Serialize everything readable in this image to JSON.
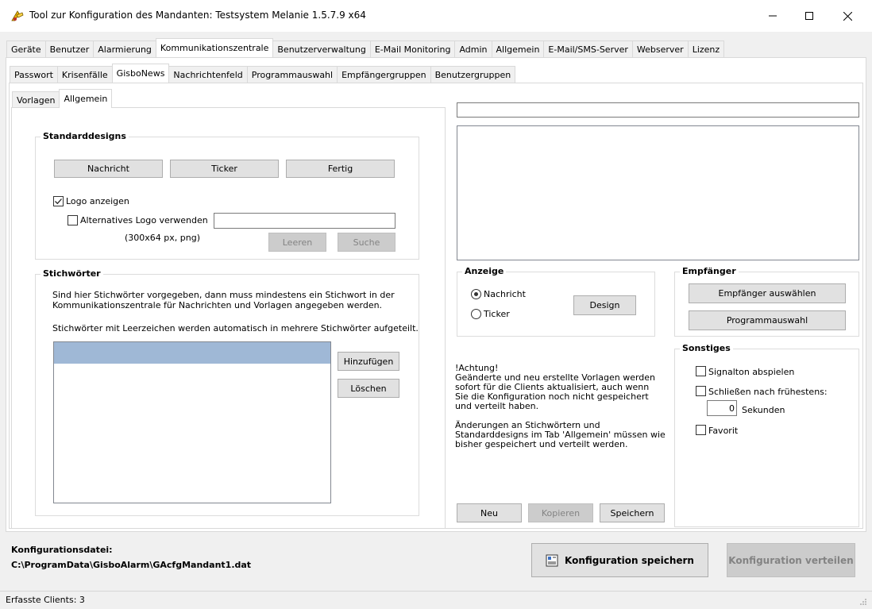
{
  "window": {
    "title": "Tool zur Konfiguration des Mandanten: Testsystem Melanie 1.5.7.9 x64"
  },
  "main_tabs": [
    {
      "label": "Geräte"
    },
    {
      "label": "Benutzer"
    },
    {
      "label": "Alarmierung"
    },
    {
      "label": "Kommunikationszentrale"
    },
    {
      "label": "Benutzerverwaltung"
    },
    {
      "label": "E-Mail Monitoring"
    },
    {
      "label": "Admin"
    },
    {
      "label": "Allgemein"
    },
    {
      "label": "E-Mail/SMS-Server"
    },
    {
      "label": "Webserver"
    },
    {
      "label": "Lizenz"
    }
  ],
  "sub_tabs": [
    {
      "label": "Passwort"
    },
    {
      "label": "Krisenfälle"
    },
    {
      "label": "GisboNews"
    },
    {
      "label": "Nachrichtenfeld"
    },
    {
      "label": "Programmauswahl"
    },
    {
      "label": "Empfängergruppen"
    },
    {
      "label": "Benutzergruppen"
    }
  ],
  "inner_tabs": [
    {
      "label": "Vorlagen"
    },
    {
      "label": "Allgemein"
    }
  ],
  "standarddesigns": {
    "title": "Standarddesigns",
    "btn_nachricht": "Nachricht",
    "btn_ticker": "Ticker",
    "btn_fertig": "Fertig",
    "logo_anzeigen": "Logo anzeigen",
    "logo_anzeigen_checked": true,
    "alt_logo": "Alternatives Logo verwenden",
    "alt_logo_checked": false,
    "alt_logo_path": "",
    "size_hint": "(300x64 px, png)",
    "btn_leeren": "Leeren",
    "btn_suche": "Suche"
  },
  "stichwoerter": {
    "title": "Stichwörter",
    "desc_line1": "Sind hier Stichwörter vorgegeben, dann muss mindestens ein Stichwort in der",
    "desc_line2": "Kommunikationszentrale für Nachrichten und Vorlagen angegeben werden.",
    "desc_line3": "Stichwörter mit Leerzeichen werden automatisch in mehrere Stichwörter aufgeteilt.",
    "btn_add": "Hinzufügen",
    "btn_delete": "Löschen"
  },
  "vorlage": {
    "title_value": "",
    "body_value": ""
  },
  "anzeige": {
    "title": "Anzeige",
    "opt_nachricht": "Nachricht",
    "opt_ticker": "Ticker",
    "selected": "Nachricht",
    "btn_design": "Design"
  },
  "empfaenger": {
    "title": "Empfänger",
    "btn_select": "Empfänger auswählen",
    "btn_programm": "Programmauswahl"
  },
  "sonstiges": {
    "title": "Sonstiges",
    "signalton": "Signalton abspielen",
    "schliessen": "Schließen nach frühestens:",
    "seconds_value": "0",
    "sekunden": "Sekunden",
    "favorit": "Favorit"
  },
  "hinweis": {
    "l1": "!Achtung!",
    "l2": "Geänderte und neu erstellte Vorlagen werden",
    "l3": "sofort für die Clients aktualisiert, auch wenn",
    "l4": "Sie die Konfiguration noch nicht gespeichert",
    "l5": "und verteilt haben.",
    "l6": "Änderungen an Stichwörtern und",
    "l7": "Standarddesigns im Tab 'Allgemein' müssen wie",
    "l8": "bisher gespeichert und verteilt werden."
  },
  "vorlage_buttons": {
    "neu": "Neu",
    "kopieren": "Kopieren",
    "speichern": "Speichern"
  },
  "footer": {
    "config_label": "Konfigurationsdatei:",
    "config_path": "C:\\ProgramData\\GisboAlarm\\GAcfgMandant1.dat",
    "btn_save": "Konfiguration speichern",
    "btn_distribute": "Konfiguration verteilen"
  },
  "status": {
    "clients": "Erfasste Clients: 3"
  }
}
